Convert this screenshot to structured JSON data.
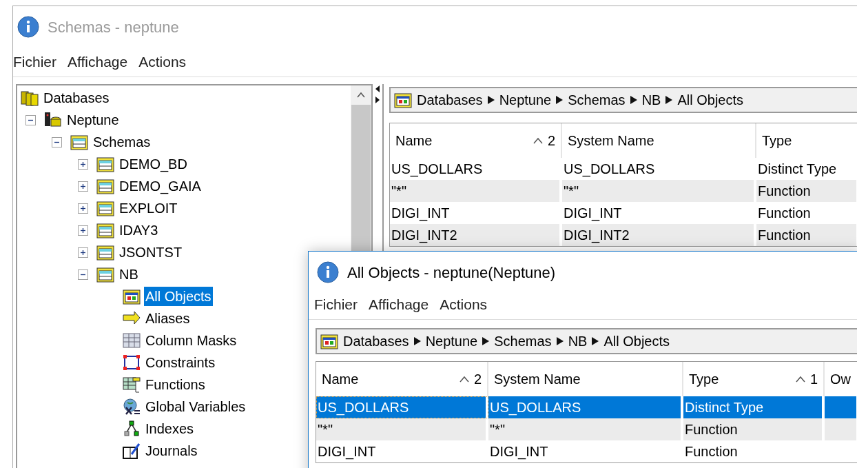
{
  "main_window": {
    "title": "Schemas - neptune",
    "active": false,
    "menu": [
      "Fichier",
      "Affichage",
      "Actions"
    ],
    "tree": [
      {
        "label": "Databases",
        "kind": "databases",
        "selected": false,
        "children": [
          {
            "label": "Neptune",
            "kind": "database",
            "expanded": true,
            "selected": false,
            "children": [
              {
                "label": "Schemas",
                "kind": "schemas",
                "expanded": true,
                "selected": false,
                "children": [
                  {
                    "label": "DEMO_BD",
                    "kind": "schema",
                    "expanded": false,
                    "selected": false
                  },
                  {
                    "label": "DEMO_GAIA",
                    "kind": "schema",
                    "expanded": false,
                    "selected": false
                  },
                  {
                    "label": "EXPLOIT",
                    "kind": "schema",
                    "expanded": false,
                    "selected": false
                  },
                  {
                    "label": "IDAY3",
                    "kind": "schema",
                    "expanded": false,
                    "selected": false
                  },
                  {
                    "label": "JSONTST",
                    "kind": "schema",
                    "expanded": false,
                    "selected": false
                  },
                  {
                    "label": "NB",
                    "kind": "schema",
                    "expanded": true,
                    "selected": false,
                    "children": [
                      {
                        "label": "All Objects",
                        "kind": "all-objects",
                        "selected": true
                      },
                      {
                        "label": "Aliases",
                        "kind": "alias",
                        "selected": false
                      },
                      {
                        "label": "Column Masks",
                        "kind": "column-mask",
                        "selected": false
                      },
                      {
                        "label": "Constraints",
                        "kind": "constraint",
                        "selected": false
                      },
                      {
                        "label": "Functions",
                        "kind": "function",
                        "selected": false
                      },
                      {
                        "label": "Global Variables",
                        "kind": "global-variable",
                        "selected": false
                      },
                      {
                        "label": "Indexes",
                        "kind": "index",
                        "selected": false
                      },
                      {
                        "label": "Journals",
                        "kind": "journal",
                        "selected": false
                      }
                    ]
                  }
                ]
              }
            ]
          }
        ]
      }
    ],
    "breadcrumb": [
      "Databases",
      "Neptune",
      "Schemas",
      "NB",
      "All Objects"
    ],
    "table": {
      "columns": [
        {
          "label": "Name",
          "sort_rank": "2"
        },
        {
          "label": "System Name"
        },
        {
          "label": "Type"
        }
      ],
      "rows": [
        {
          "cells": [
            "US_DOLLARS",
            "US_DOLLARS",
            "Distinct Type"
          ],
          "selected": false
        },
        {
          "cells": [
            "\"*\"",
            "\"*\"",
            "Function"
          ],
          "selected": false
        },
        {
          "cells": [
            "DIGI_INT",
            "DIGI_INT",
            "Function"
          ],
          "selected": false
        },
        {
          "cells": [
            "DIGI_INT2",
            "DIGI_INT2",
            "Function"
          ],
          "selected": false
        }
      ]
    }
  },
  "child_window": {
    "title": "All Objects - neptune(Neptune)",
    "active": true,
    "menu": [
      "Fichier",
      "Affichage",
      "Actions"
    ],
    "breadcrumb": [
      "Databases",
      "Neptune",
      "Schemas",
      "NB",
      "All Objects"
    ],
    "table": {
      "columns": [
        {
          "label": "Name",
          "sort_rank": "2"
        },
        {
          "label": "System Name"
        },
        {
          "label": "Type",
          "sort_rank": "1"
        },
        {
          "label": "Ow"
        }
      ],
      "rows": [
        {
          "cells": [
            "US_DOLLARS",
            "US_DOLLARS",
            "Distinct Type",
            ""
          ],
          "selected": true
        },
        {
          "cells": [
            "\"*\"",
            "\"*\"",
            "Function",
            ""
          ],
          "selected": false
        },
        {
          "cells": [
            "DIGI_INT",
            "DIGI_INT",
            "Function",
            ""
          ],
          "selected": false
        }
      ]
    }
  }
}
